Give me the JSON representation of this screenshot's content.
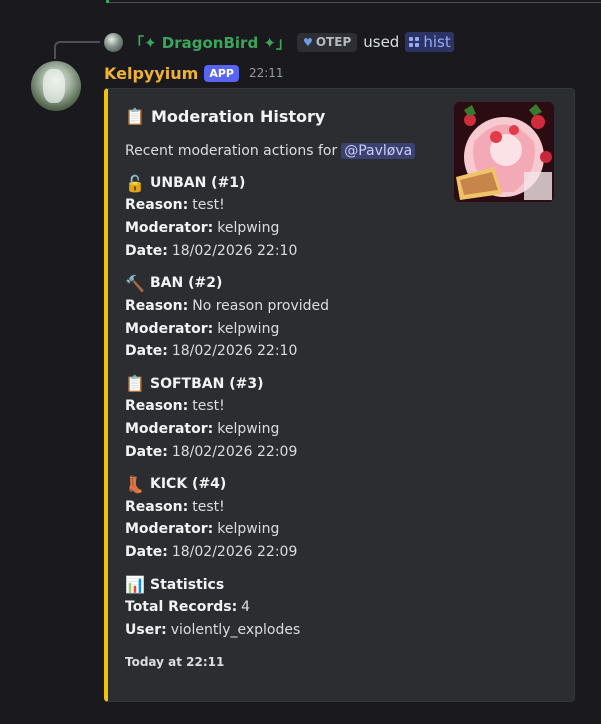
{
  "reply": {
    "name": "「✦ DragonBird ✦」",
    "tag": "OTEP",
    "used_text": "used",
    "command": "hist"
  },
  "message": {
    "username": "Kelpyyium",
    "badge": "APP",
    "time": "22:11"
  },
  "embed": {
    "accent_color": "#f0c30c",
    "title_emoji": "📋",
    "title": "Moderation History",
    "description": "Recent moderation actions for",
    "mention": "@Pavløva",
    "entries": [
      {
        "emoji": "🔓",
        "name": "UNBAN (#1)",
        "reason": "test!",
        "moderator": "kelpwing",
        "date": "18/02/2026 22:10"
      },
      {
        "emoji": "🔨",
        "name": "BAN (#2)",
        "reason": "No reason provided",
        "moderator": "kelpwing",
        "date": "18/02/2026 22:10"
      },
      {
        "emoji": "📋",
        "name": "SOFTBAN (#3)",
        "reason": "test!",
        "moderator": "kelpwing",
        "date": "18/02/2026 22:09"
      },
      {
        "emoji": "👢",
        "name": "KICK (#4)",
        "reason": "test!",
        "moderator": "kelpwing",
        "date": "18/02/2026 22:09"
      }
    ],
    "labels": {
      "reason": "Reason:",
      "moderator": "Moderator:",
      "date": "Date:"
    },
    "stats": {
      "emoji": "📊",
      "title": "Statistics",
      "total_label": "Total Records:",
      "total_value": "4",
      "user_label": "User:",
      "user_value": "violently_explodes"
    },
    "footer": "Today at 22:11"
  }
}
